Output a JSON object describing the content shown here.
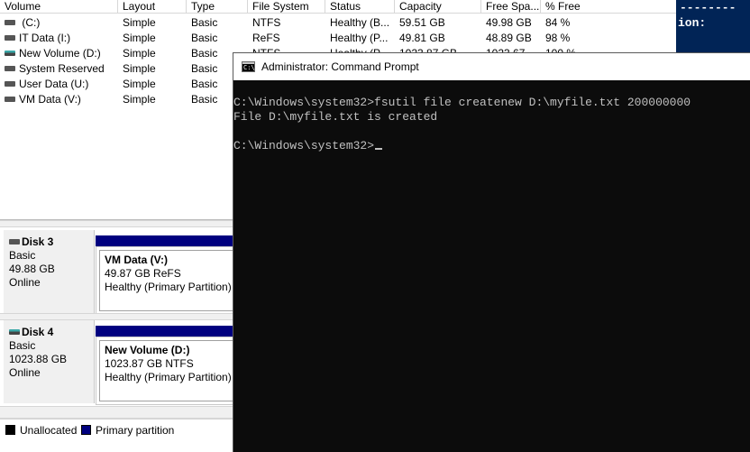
{
  "volume_list": {
    "columns": [
      "Volume",
      "Layout",
      "Type",
      "File System",
      "Status",
      "Capacity",
      "Free Spa...",
      "% Free"
    ],
    "rows": [
      {
        "volume": " (C:)",
        "layout": "Simple",
        "type": "Basic",
        "fs": "NTFS",
        "status": "Healthy (B...",
        "capacity": "59.51 GB",
        "free": "49.98 GB",
        "pct": "84 %",
        "icon": "drive-icon"
      },
      {
        "volume": "IT Data (I:)",
        "layout": "Simple",
        "type": "Basic",
        "fs": "ReFS",
        "status": "Healthy (P...",
        "capacity": "49.81 GB",
        "free": "48.89 GB",
        "pct": "98 %",
        "icon": "drive-icon"
      },
      {
        "volume": "New Volume (D:)",
        "layout": "Simple",
        "type": "Basic",
        "fs": "NTFS",
        "status": "Healthy (P...",
        "capacity": "1023.87 GB",
        "free": "1023.67...",
        "pct": "100 %",
        "icon": "drive-icon-teal"
      },
      {
        "volume": "System Reserved",
        "layout": "Simple",
        "type": "Basic",
        "fs": "",
        "status": "",
        "capacity": "",
        "free": "",
        "pct": "",
        "icon": "drive-icon"
      },
      {
        "volume": "User Data (U:)",
        "layout": "Simple",
        "type": "Basic",
        "fs": "",
        "status": "",
        "capacity": "",
        "free": "",
        "pct": "",
        "icon": "drive-icon"
      },
      {
        "volume": "VM Data (V:)",
        "layout": "Simple",
        "type": "Basic",
        "fs": "",
        "status": "",
        "capacity": "",
        "free": "",
        "pct": "",
        "icon": "drive-icon"
      }
    ]
  },
  "disks": [
    {
      "name": "Disk 3",
      "type": "Basic",
      "size": "49.88 GB",
      "state": "Online",
      "icon": "drive-icon",
      "partition": {
        "name": "VM Data  (V:)",
        "detail": "49.87 GB ReFS",
        "status": "Healthy (Primary Partition)"
      }
    },
    {
      "name": "Disk 4",
      "type": "Basic",
      "size": "1023.88 GB",
      "state": "Online",
      "icon": "drive-icon-teal",
      "partition": {
        "name": "New Volume  (D:)",
        "detail": "1023.87 GB NTFS",
        "status": "Healthy (Primary Partition)"
      }
    }
  ],
  "legend": {
    "unallocated": "Unallocated",
    "primary": "Primary partition",
    "colors": {
      "unallocated": "#000000",
      "primary": "#00007f"
    }
  },
  "background_window": {
    "dashes": "--------",
    "text": "ion:",
    "bg_color": "#012456"
  },
  "cmd": {
    "title": "Administrator: Command Prompt",
    "icon_label": "C:\\",
    "lines": [
      "C:\\Windows\\system32>fsutil file createnew D:\\myfile.txt 200000000",
      "File D:\\myfile.txt is created",
      "",
      "C:\\Windows\\system32>"
    ]
  }
}
